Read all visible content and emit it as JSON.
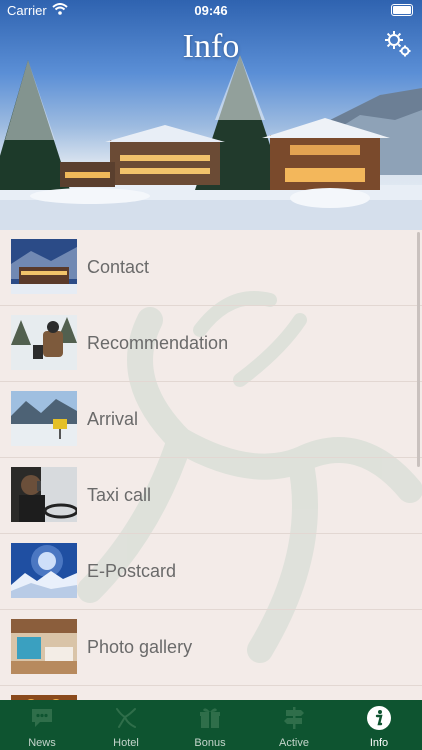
{
  "status": {
    "carrier": "Carrier",
    "time": "09:46"
  },
  "header": {
    "title": "Info"
  },
  "menu": [
    {
      "label": "Contact"
    },
    {
      "label": "Recommendation"
    },
    {
      "label": "Arrival"
    },
    {
      "label": "Taxi call"
    },
    {
      "label": "E-Postcard"
    },
    {
      "label": "Photo gallery"
    },
    {
      "label": ""
    }
  ],
  "tabs": [
    {
      "label": "News"
    },
    {
      "label": "Hotel"
    },
    {
      "label": "Bonus"
    },
    {
      "label": "Active"
    },
    {
      "label": "Info"
    }
  ]
}
